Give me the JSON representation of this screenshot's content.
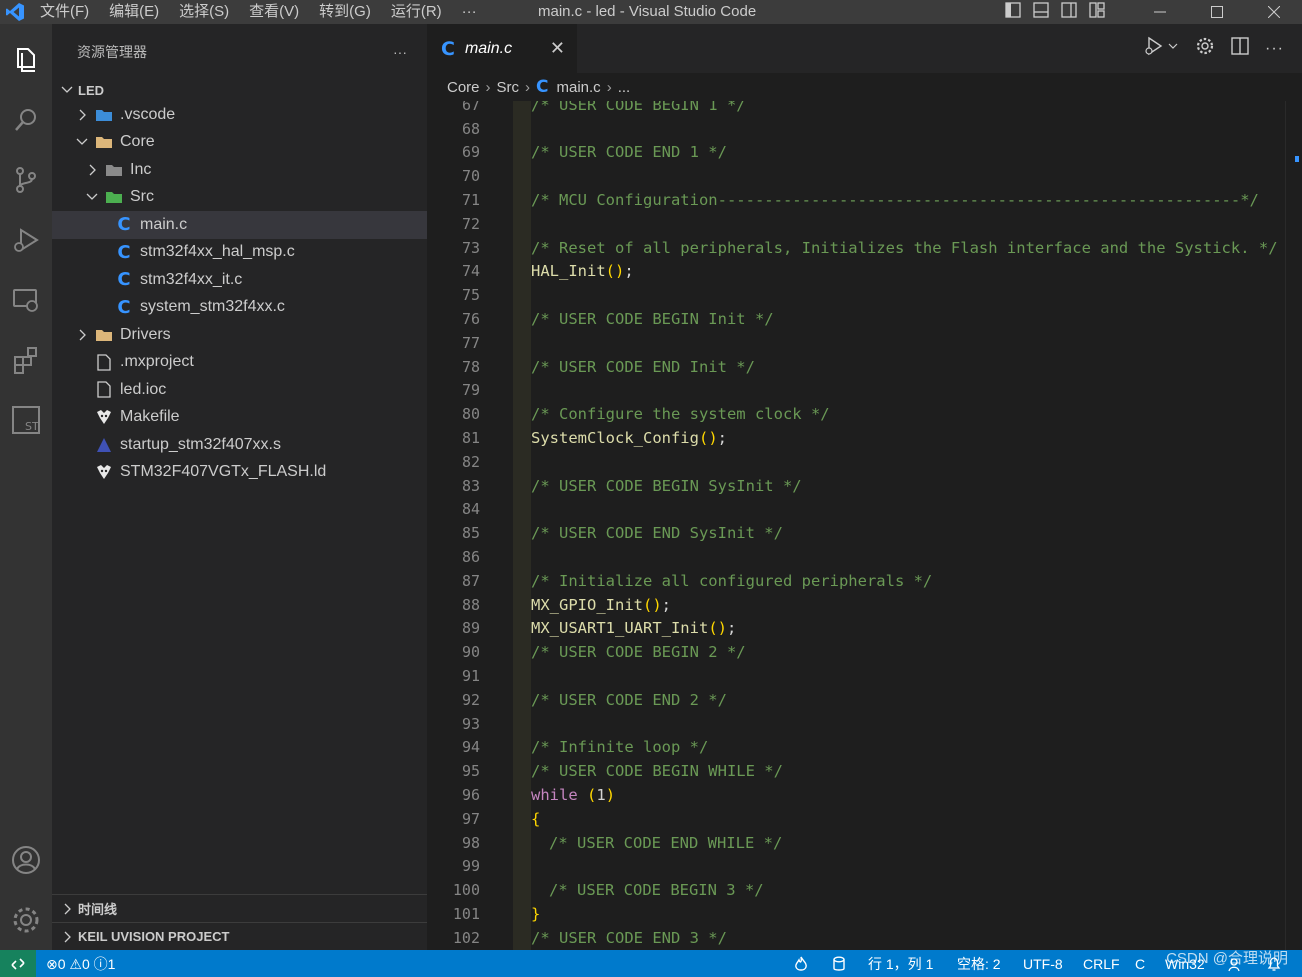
{
  "titlebar": {
    "menu": [
      "文件(F)",
      "编辑(E)",
      "选择(S)",
      "查看(V)",
      "转到(G)",
      "运行(R)",
      "···"
    ],
    "title": "main.c - led - Visual Studio Code"
  },
  "activitybar": {
    "items": [
      "explorer-icon",
      "search-icon",
      "source-control-icon",
      "run-debug-icon",
      "remote-explorer-icon",
      "extensions-icon",
      "st-icon"
    ],
    "bottom": [
      "account-icon",
      "manage-gear-icon"
    ]
  },
  "sidebar": {
    "title": "资源管理器",
    "more": "···",
    "root": "LED",
    "tree": [
      {
        "label": ".vscode",
        "indent": 1,
        "chev": "right",
        "icon": "folder-vscode-icon"
      },
      {
        "label": "Core",
        "indent": 1,
        "chev": "down",
        "icon": "folder-open-icon"
      },
      {
        "label": "Inc",
        "indent": 2,
        "chev": "right",
        "icon": "folder-inc-icon"
      },
      {
        "label": "Src",
        "indent": 2,
        "chev": "down",
        "icon": "folder-src-icon"
      },
      {
        "label": "main.c",
        "indent": 3,
        "chev": "",
        "icon": "c-file-icon",
        "selected": true
      },
      {
        "label": "stm32f4xx_hal_msp.c",
        "indent": 3,
        "chev": "",
        "icon": "c-file-icon"
      },
      {
        "label": "stm32f4xx_it.c",
        "indent": 3,
        "chev": "",
        "icon": "c-file-icon"
      },
      {
        "label": "system_stm32f4xx.c",
        "indent": 3,
        "chev": "",
        "icon": "c-file-icon"
      },
      {
        "label": "Drivers",
        "indent": 1,
        "chev": "right",
        "icon": "folder-icon"
      },
      {
        "label": ".mxproject",
        "indent": 1,
        "chev": "",
        "icon": "file-icon"
      },
      {
        "label": "led.ioc",
        "indent": 1,
        "chev": "",
        "icon": "file-icon"
      },
      {
        "label": "Makefile",
        "indent": 1,
        "chev": "",
        "icon": "makefile-icon"
      },
      {
        "label": "startup_stm32f407xx.s",
        "indent": 1,
        "chev": "",
        "icon": "asm-file-icon"
      },
      {
        "label": "STM32F407VGTx_FLASH.ld",
        "indent": 1,
        "chev": "",
        "icon": "makefile-icon"
      }
    ],
    "timeline": "时间线",
    "keil": "KEIL UVISION PROJECT"
  },
  "editor": {
    "tab": "main.c",
    "tab_close": "✕",
    "breadcrumb": [
      "Core",
      "Src",
      "main.c",
      "..."
    ],
    "lines": [
      {
        "n": "67",
        "text": "/* USER CODE BEGIN 1 */",
        "kind": "cm",
        "indent": 1
      },
      {
        "n": "68",
        "text": "",
        "kind": "",
        "indent": 0
      },
      {
        "n": "69",
        "text": "/* USER CODE END 1 */",
        "kind": "cm",
        "indent": 1
      },
      {
        "n": "70",
        "text": "",
        "kind": "",
        "indent": 0
      },
      {
        "n": "71",
        "text": "/* MCU Configuration--------------------------------------------------------*/",
        "kind": "cm",
        "indent": 1
      },
      {
        "n": "72",
        "text": "",
        "kind": "",
        "indent": 0
      },
      {
        "n": "73",
        "text": "/* Reset of all peripherals, Initializes the Flash interface and the Systick. */",
        "kind": "cm",
        "indent": 1
      },
      {
        "n": "74",
        "text": "HAL_Init();",
        "kind": "call",
        "fn": "HAL_Init",
        "indent": 1
      },
      {
        "n": "75",
        "text": "",
        "kind": "",
        "indent": 0
      },
      {
        "n": "76",
        "text": "/* USER CODE BEGIN Init */",
        "kind": "cm",
        "indent": 1
      },
      {
        "n": "77",
        "text": "",
        "kind": "",
        "indent": 0
      },
      {
        "n": "78",
        "text": "/* USER CODE END Init */",
        "kind": "cm",
        "indent": 1
      },
      {
        "n": "79",
        "text": "",
        "kind": "",
        "indent": 0
      },
      {
        "n": "80",
        "text": "/* Configure the system clock */",
        "kind": "cm",
        "indent": 1
      },
      {
        "n": "81",
        "text": "SystemClock_Config();",
        "kind": "call",
        "fn": "SystemClock_Config",
        "indent": 1
      },
      {
        "n": "82",
        "text": "",
        "kind": "",
        "indent": 0
      },
      {
        "n": "83",
        "text": "/* USER CODE BEGIN SysInit */",
        "kind": "cm",
        "indent": 1
      },
      {
        "n": "84",
        "text": "",
        "kind": "",
        "indent": 0
      },
      {
        "n": "85",
        "text": "/* USER CODE END SysInit */",
        "kind": "cm",
        "indent": 1
      },
      {
        "n": "86",
        "text": "",
        "kind": "",
        "indent": 0
      },
      {
        "n": "87",
        "text": "/* Initialize all configured peripherals */",
        "kind": "cm",
        "indent": 1
      },
      {
        "n": "88",
        "text": "MX_GPIO_Init();",
        "kind": "call",
        "fn": "MX_GPIO_Init",
        "indent": 1
      },
      {
        "n": "89",
        "text": "MX_USART1_UART_Init();",
        "kind": "call",
        "fn": "MX_USART1_UART_Init",
        "indent": 1
      },
      {
        "n": "90",
        "text": "/* USER CODE BEGIN 2 */",
        "kind": "cm",
        "indent": 1
      },
      {
        "n": "91",
        "text": "",
        "kind": "",
        "indent": 0
      },
      {
        "n": "92",
        "text": "/* USER CODE END 2 */",
        "kind": "cm",
        "indent": 1
      },
      {
        "n": "93",
        "text": "",
        "kind": "",
        "indent": 0
      },
      {
        "n": "94",
        "text": "/* Infinite loop */",
        "kind": "cm",
        "indent": 1
      },
      {
        "n": "95",
        "text": "/* USER CODE BEGIN WHILE */",
        "kind": "cm",
        "indent": 1
      },
      {
        "n": "96",
        "text": "while (1)",
        "kind": "while",
        "indent": 1
      },
      {
        "n": "97",
        "text": "{",
        "kind": "brace",
        "indent": 1
      },
      {
        "n": "98",
        "text": "/* USER CODE END WHILE */",
        "kind": "cm",
        "indent": 2
      },
      {
        "n": "99",
        "text": "",
        "kind": "",
        "indent": 0
      },
      {
        "n": "100",
        "text": "/* USER CODE BEGIN 3 */",
        "kind": "cm",
        "indent": 2
      },
      {
        "n": "101",
        "text": "}",
        "kind": "brace",
        "indent": 1
      },
      {
        "n": "102",
        "text": "/* USER CODE END 3 */",
        "kind": "cm",
        "indent": 1
      }
    ]
  },
  "statusbar": {
    "problems": "⊗0 ⚠0 ⓘ1",
    "position": "行 1，列 1",
    "spaces": "空格: 2",
    "encoding": "UTF-8",
    "eol": "CRLF",
    "language": "C",
    "platform": "Win32",
    "csdn": "CSDN @合理说明"
  },
  "colors": {
    "statusbar": "#007acc",
    "comment": "#6a9955",
    "function": "#dcdcaa",
    "keyword": "#c586c0",
    "bracket": "#ffd700"
  }
}
